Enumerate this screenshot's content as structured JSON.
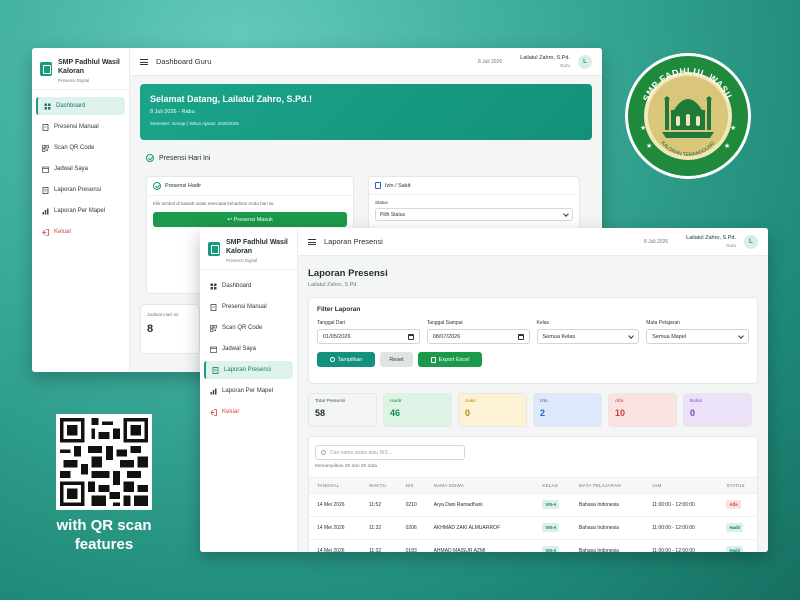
{
  "brand": {
    "name": "SMP Fadhlul Wasil Kaloran",
    "sub": "Presensi Digital"
  },
  "back_window": {
    "nav": [
      "Dashboard",
      "Presensi Manual",
      "Scan QR Code",
      "Jadwal Saya",
      "Laporan Presensi",
      "Laporan Per Mapel",
      "Keluar"
    ],
    "active_index": 0,
    "topbar": {
      "title": "Dashboard Guru",
      "date": "8 Juli 2026",
      "user": "Lailatul Zahro, S.Pd.",
      "role": "Guru",
      "avatar": "L"
    },
    "welcome": {
      "title": "Selamat Datang, Lailatul Zahro, S.Pd.!",
      "date": "8 Juli 2026 - Rabu",
      "semester": "Semester: Genap | Tahun Ajaran: 2025/2026"
    },
    "section_title": "Presensi Hari Ini",
    "hadir_card": {
      "title": "Presensi Hadir",
      "text": "Klik tombol di bawah untuk mencatat kehadiran Anda hari ini.",
      "button": "Presensi Masuk"
    },
    "izin_card": {
      "title": "Izin / Sakit",
      "status_label": "Status",
      "status_value": "Pilih Status"
    },
    "jadwal": {
      "label": "Jadwal Hari Ini",
      "value": "8"
    }
  },
  "front_window": {
    "nav": [
      "Dashboard",
      "Presensi Manual",
      "Scan QR Code",
      "Jadwal Saya",
      "Laporan Presensi",
      "Laporan Per Mapel",
      "Keluar"
    ],
    "active_index": 4,
    "topbar": {
      "title": "Laporan Presensi",
      "date": "8 Juli 2026",
      "user": "Lailatul Zahro, S.Pd.",
      "role": "Guru",
      "avatar": "L"
    },
    "page_title": "Laporan Presensi",
    "page_sub": "Lailatul Zahro, S.Pd.",
    "filter": {
      "title": "Filter Laporan",
      "fields": [
        {
          "label": "Tanggal Dari",
          "value": "01/05/2026",
          "kind": "date"
        },
        {
          "label": "Tanggal Sampai",
          "value": "08/07/2026",
          "kind": "date"
        },
        {
          "label": "Kelas",
          "value": "Semua Kelas",
          "kind": "select"
        },
        {
          "label": "Mata Pelajaran",
          "value": "Semua Mapel",
          "kind": "select"
        }
      ],
      "show_button": "Tampilkan",
      "reset_button": "Reset",
      "export_button": "Export Excel"
    },
    "stats": [
      {
        "label": "Total Presensi",
        "value": "58",
        "bg": "#f3f6f5",
        "fg": "#1f2d2a"
      },
      {
        "label": "Hadir",
        "value": "46",
        "bg": "#dcf3e6",
        "fg": "#1a8a4a"
      },
      {
        "label": "Sakit",
        "value": "0",
        "bg": "#fdf3d4",
        "fg": "#b58a12"
      },
      {
        "label": "Izin",
        "value": "2",
        "bg": "#dde8fb",
        "fg": "#2a63c4"
      },
      {
        "label": "Alfa",
        "value": "10",
        "bg": "#fbe2e2",
        "fg": "#c73b3b"
      },
      {
        "label": "Bolos",
        "value": "0",
        "bg": "#ece2f8",
        "fg": "#7a3fc4"
      }
    ],
    "search_placeholder": "Cari nama siswa atau NIS...",
    "showing": "Menampilkan 20 dari 20 data",
    "columns": [
      "TANGGAL",
      "WAKTU",
      "NIS",
      "NAMA SISWA",
      "KELAS",
      "MATA PELAJARAN",
      "JAM",
      "STATUS"
    ],
    "rows": [
      [
        "14 Mei 2026",
        "11:52",
        "0210",
        "Arya Dani Ramadhani",
        "VIII-A",
        "Bahasa Indonesia",
        "11:00:00 - 12:00:00",
        "Alfa"
      ],
      [
        "14 Mei 2026",
        "11:32",
        "0206",
        "AKHMAD ZAKI ALMUARROF",
        "VIII-A",
        "Bahasa Indonesia",
        "11:00:00 - 12:00:00",
        "Hadir"
      ],
      [
        "14 Mei 2026",
        "11:32",
        "0183",
        "AHMAD MAISUR AZMI",
        "VIII-A",
        "Bahasa Indonesia",
        "11:00:00 - 12:00:00",
        "Hadir"
      ]
    ]
  },
  "emblem": {
    "top_text": "SMP FADHLUL WASIL",
    "bottom_text": "KALORAN TEMANGGUNG"
  },
  "caption": {
    "line1": "with QR scan",
    "line2": "features"
  }
}
